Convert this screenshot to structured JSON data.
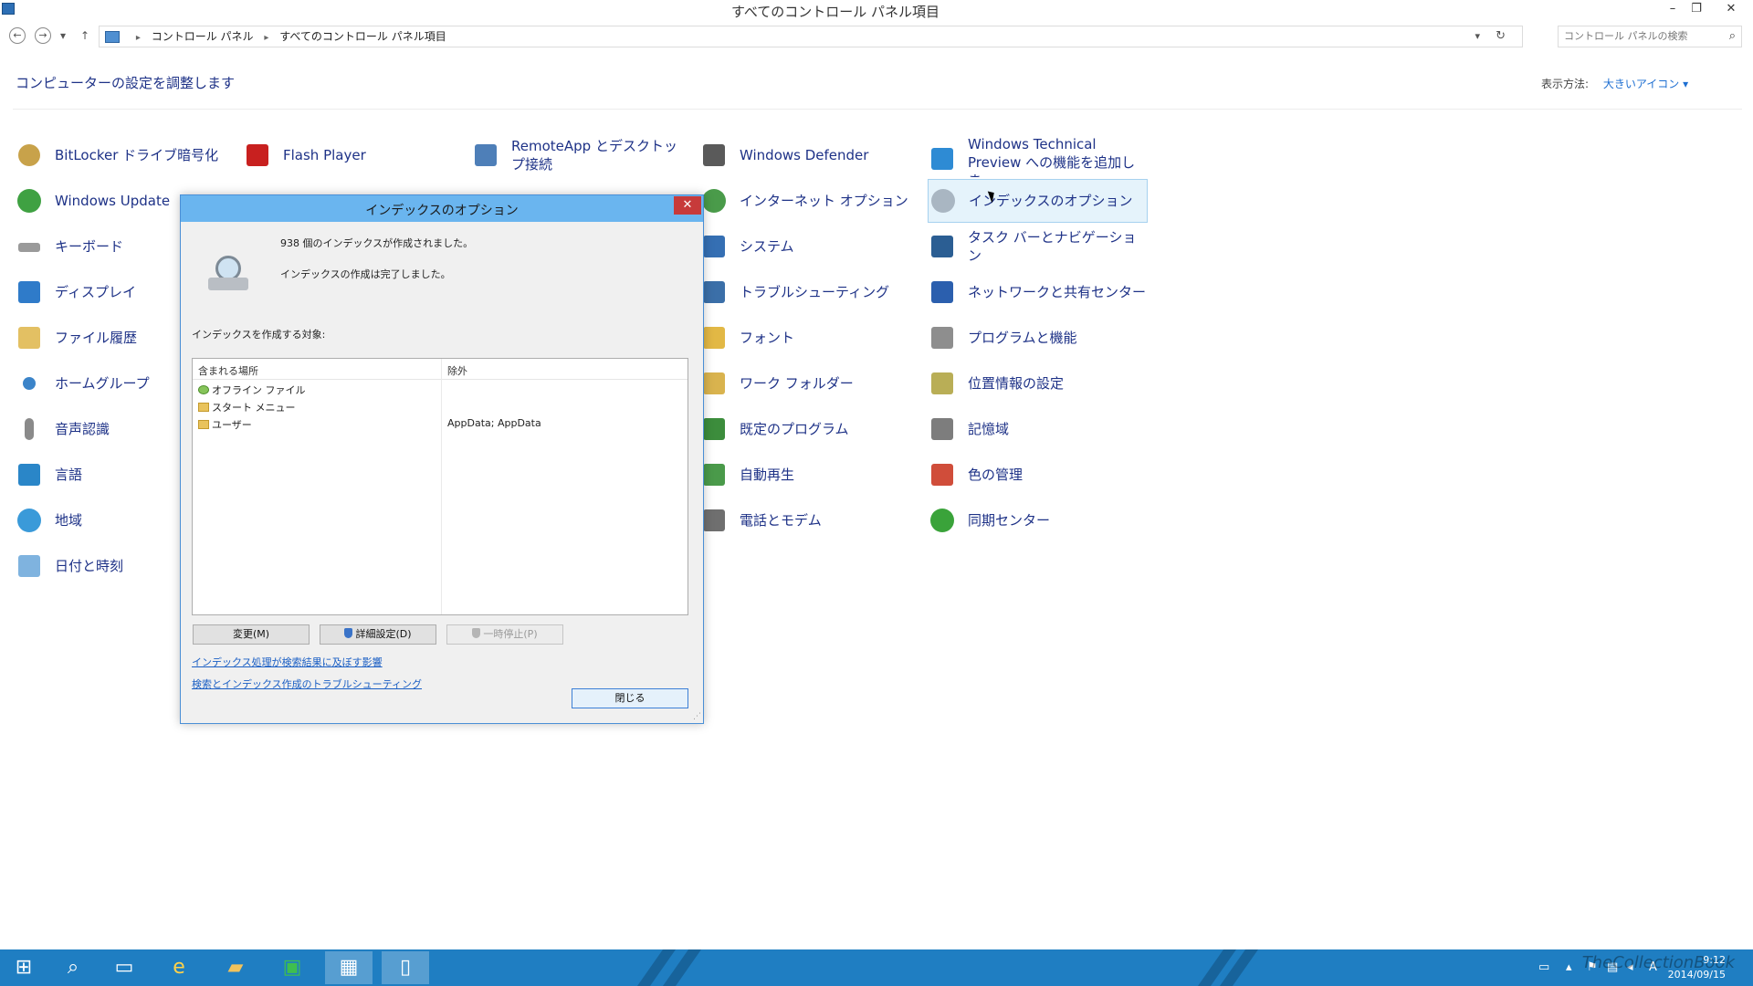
{
  "window": {
    "title": "すべてのコントロール パネル項目",
    "controls": {
      "minimize": "–",
      "restore": "❐",
      "close": "✕"
    }
  },
  "address": {
    "crumbs": [
      "コントロール パネル",
      "すべてのコントロール パネル項目"
    ],
    "search_placeholder": "コントロール パネルの検索"
  },
  "header": {
    "title": "コンピューターの設定を調整します",
    "view_label": "表示方法:",
    "view_value": "大きいアイコン ▾"
  },
  "items": [
    {
      "label": "BitLocker ドライブ暗号化"
    },
    {
      "label": "Flash Player"
    },
    {
      "label": "RemoteApp とデスクトップ接続"
    },
    {
      "label": "Windows Defender"
    },
    {
      "label": "Windows Technical Preview への機能を追加しま"
    },
    {
      "label": "Windows Update"
    },
    {
      "label": "インターネット オプション"
    },
    {
      "label": "インデックスのオプション"
    },
    {
      "label": "キーボード"
    },
    {
      "label": "システム"
    },
    {
      "label": "タスク バーとナビゲーション"
    },
    {
      "label": "ディスプレイ"
    },
    {
      "label": "トラブルシューティング"
    },
    {
      "label": "ネットワークと共有センター"
    },
    {
      "label": "ファイル履歴"
    },
    {
      "label": "フォント"
    },
    {
      "label": "プログラムと機能"
    },
    {
      "label": "ホームグループ"
    },
    {
      "label": "ワーク フォルダー"
    },
    {
      "label": "位置情報の設定"
    },
    {
      "label": "音声認識"
    },
    {
      "label": "既定のプログラム"
    },
    {
      "label": "記憶域"
    },
    {
      "label": "言語"
    },
    {
      "label": "自動再生"
    },
    {
      "label": "色の管理"
    },
    {
      "label": "地域"
    },
    {
      "label": "電話とモデム"
    },
    {
      "label": "同期センター"
    },
    {
      "label": "日付と時刻"
    }
  ],
  "dialog": {
    "title": "インデックスのオプション",
    "close": "✕",
    "status_count": "938 個のインデックスが作成されました。",
    "status_done": "インデックスの作成は完了しました。",
    "list_label": "インデックスを作成する対象:",
    "columns": [
      "含まれる場所",
      "除外"
    ],
    "rows": [
      {
        "location": "オフライン ファイル",
        "exclude": ""
      },
      {
        "location": "スタート メニュー",
        "exclude": ""
      },
      {
        "location": "ユーザー",
        "exclude": "AppData; AppData"
      }
    ],
    "buttons": {
      "modify": "変更(M)",
      "advanced": "詳細設定(D)",
      "pause": "一時停止(P)",
      "close": "閉じる"
    },
    "links": [
      "インデックス処理が検索結果に及ぼす影響",
      "検索とインデックス作成のトラブルシューティング"
    ]
  },
  "taskbar": {
    "clock_time": "9:12",
    "clock_date": "2014/09/15",
    "ime": "A",
    "watermark": "TheCollectionBook"
  }
}
